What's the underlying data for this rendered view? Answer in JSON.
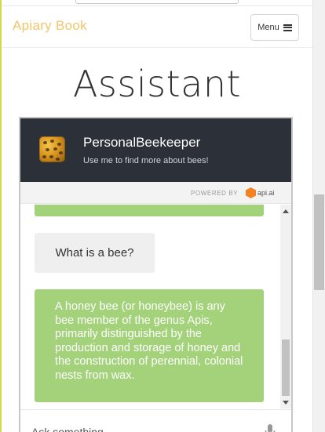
{
  "navbar": {
    "brand": "Apiary Book",
    "menu_label": "Menu",
    "menu_icon": "hamburger-icon"
  },
  "page": {
    "title": "Assistant"
  },
  "chat": {
    "bot_name": "PersonalBeekeeper",
    "bot_tagline": "Use me to find more about bees!",
    "bot_avatar": "honeycomb-bees-image",
    "powered_by": "POWERED BY",
    "provider": "api.ai",
    "messages": [
      {
        "from": "user",
        "text": "What is a bee?"
      },
      {
        "from": "bot",
        "text": "A honey bee (or honeybee) is any bee member of the genus Apis, primarily distinguished by the production and storage of honey and the construction of perennial, colonial nests from wax."
      }
    ],
    "input_placeholder": "Ask something...",
    "mic_icon": "microphone-icon"
  },
  "colors": {
    "brand": "#f2c56b",
    "header_bg": "#2c3039",
    "bot_bubble": "#a3d27a",
    "user_bubble": "#efefef"
  }
}
